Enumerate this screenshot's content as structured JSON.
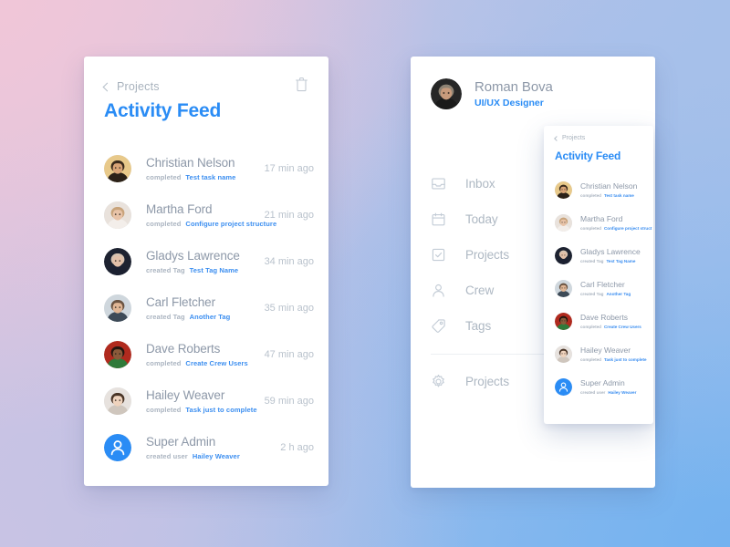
{
  "background": {
    "colors": {
      "top_left": "#f0c6d8",
      "top_right": "#a6c0ea",
      "bottom_left": "#c8c3e4",
      "bottom_right": "#74b2ef"
    }
  },
  "theme": {
    "accent": "#2a8cf5",
    "link": "#3b8ef0",
    "name_text": "#8d98a8",
    "muted_text": "#aab4c0",
    "time_text": "#b9c2cc"
  },
  "left_card": {
    "breadcrumb": {
      "icon": "chevron-left-icon",
      "label": "Projects"
    },
    "delete_icon": "trash-icon",
    "title": "Activity Feed",
    "feed": [
      {
        "name": "Christian Nelson",
        "action": "completed",
        "target": "Test task name",
        "time": "17 min ago",
        "avatar": "photo-male-1"
      },
      {
        "name": "Martha Ford",
        "action": "completed",
        "target": "Configure project structure",
        "time": "21 min ago",
        "avatar": "photo-female-1"
      },
      {
        "name": "Gladys Lawrence",
        "action": "created Tag",
        "target": "Test Tag Name",
        "time": "34 min ago",
        "avatar": "photo-female-2"
      },
      {
        "name": "Carl Fletcher",
        "action": "created Tag",
        "target": "Another Tag",
        "time": "35 min ago",
        "avatar": "photo-male-2"
      },
      {
        "name": "Dave Roberts",
        "action": "completed",
        "target": "Create Crew Users",
        "time": "47 min ago",
        "avatar": "photo-male-3"
      },
      {
        "name": "Hailey Weaver",
        "action": "completed",
        "target": "Task just to complete",
        "time": "59 min ago",
        "avatar": "photo-female-3"
      },
      {
        "name": "Super Admin",
        "action": "created user",
        "target": "Hailey Weaver",
        "time": "2 h ago",
        "avatar": "user-glyph-blue"
      }
    ]
  },
  "right_card": {
    "profile": {
      "avatar": "photo-roman",
      "name": "Roman Bova",
      "role": "UI/UX Designer"
    },
    "nav": [
      {
        "icon": "inbox-icon",
        "label": "Inbox"
      },
      {
        "icon": "calendar-icon",
        "label": "Today"
      },
      {
        "icon": "check-square-icon",
        "label": "Projects"
      },
      {
        "icon": "person-icon",
        "label": "Crew"
      },
      {
        "icon": "tag-icon",
        "label": "Tags"
      }
    ],
    "nav_footer": [
      {
        "icon": "gear-icon",
        "label": "Projects"
      }
    ]
  },
  "overlay_card": {
    "breadcrumb": {
      "icon": "chevron-left-icon",
      "label": "Projects"
    },
    "title": "Activity Feed",
    "feed": [
      {
        "name": "Christian Nelson",
        "action": "completed",
        "target": "Test task name",
        "avatar": "photo-male-1"
      },
      {
        "name": "Martha Ford",
        "action": "completed",
        "target": "Configure project struct",
        "avatar": "photo-female-1"
      },
      {
        "name": "Gladys Lawrence",
        "action": "created Tag",
        "target": "Test Tag Name",
        "avatar": "photo-female-2"
      },
      {
        "name": "Carl Fletcher",
        "action": "created Tag",
        "target": "Another Tag",
        "avatar": "photo-male-2"
      },
      {
        "name": "Dave Roberts",
        "action": "completed",
        "target": "Create Crew Users",
        "avatar": "photo-male-3"
      },
      {
        "name": "Hailey Weaver",
        "action": "completed",
        "target": "Task just to complete",
        "avatar": "photo-female-3"
      },
      {
        "name": "Super Admin",
        "action": "created user",
        "target": "Hailey Weaver",
        "avatar": "user-glyph-blue"
      }
    ]
  }
}
